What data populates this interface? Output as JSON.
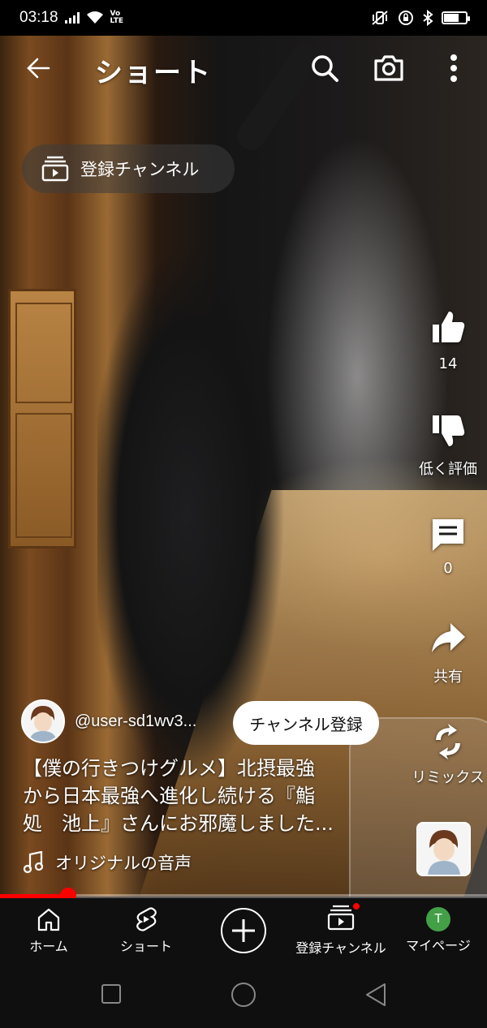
{
  "status_bar": {
    "time": "03:18",
    "network_label": "Vo LTE",
    "battery_level": 0.7
  },
  "header": {
    "title": "ショート",
    "back_icon": "arrow-left-icon",
    "search_icon": "search-icon",
    "camera_icon": "camera-icon",
    "more_icon": "more-vert-icon"
  },
  "subscriptions_chip": {
    "label": "登録チャンネル"
  },
  "actions": {
    "like": {
      "count": "14"
    },
    "dislike": {
      "label": "低く評価"
    },
    "comments": {
      "count": "0"
    },
    "share": {
      "label": "共有"
    },
    "remix": {
      "label": "リミックス"
    }
  },
  "video": {
    "channel_handle": "@user-sd1wv3...",
    "subscribe_label": "チャンネル登録",
    "title_line1": "【僕の行きつけグルメ】北摂最強",
    "title_line2": "から日本最強へ進化し続ける『鮨",
    "title_line3": "処　池上』さんにお邪魔しました...",
    "sound_label": "オリジナルの音声",
    "progress_fraction": 0.14
  },
  "bottom_nav": {
    "items": [
      {
        "label": "ホーム",
        "icon": "home-icon"
      },
      {
        "label": "ショート",
        "icon": "shorts-icon"
      },
      {
        "label": "",
        "icon": "create-icon"
      },
      {
        "label": "登録チャンネル",
        "icon": "subscriptions-icon"
      },
      {
        "label": "マイページ",
        "icon": "account-icon",
        "avatar_letter": "T"
      }
    ]
  },
  "colors": {
    "accent_red": "#ff0000",
    "nav_background": "#0f0f0f",
    "avatar_green": "#43a047"
  }
}
